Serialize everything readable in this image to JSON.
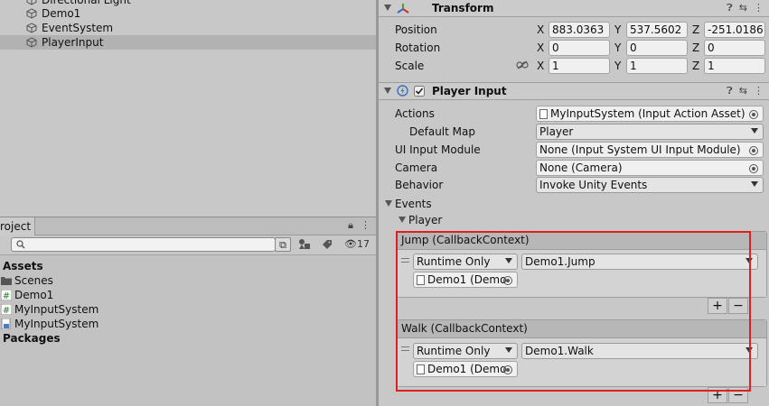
{
  "hierarchy": {
    "items": [
      {
        "label": "Directional Light"
      },
      {
        "label": "Demo1"
      },
      {
        "label": "EventSystem"
      },
      {
        "label": "PlayerInput",
        "selected": true
      }
    ]
  },
  "project": {
    "tab_label": "roject",
    "search_placeholder": "",
    "hidden_count": "17",
    "items": [
      {
        "label": "Assets",
        "kind": "root"
      },
      {
        "label": "Scenes",
        "kind": "folder"
      },
      {
        "label": "Demo1",
        "kind": "script"
      },
      {
        "label": "MyInputSystem",
        "kind": "script"
      },
      {
        "label": "MyInputSystem",
        "kind": "asset"
      },
      {
        "label": "Packages",
        "kind": "root"
      }
    ]
  },
  "transform": {
    "title": "Transform",
    "position_label": "Position",
    "rotation_label": "Rotation",
    "scale_label": "Scale",
    "axis_x": "X",
    "axis_y": "Y",
    "axis_z": "Z",
    "position": {
      "x": "883.0363",
      "y": "537.5602",
      "z": "-251.0186"
    },
    "rotation": {
      "x": "0",
      "y": "0",
      "z": "0"
    },
    "scale": {
      "x": "1",
      "y": "1",
      "z": "1"
    }
  },
  "player_input": {
    "title": "Player Input",
    "enabled": true,
    "actions_label": "Actions",
    "actions_value": "MyInputSystem (Input Action Asset)",
    "default_map_label": "Default Map",
    "default_map_value": "Player",
    "ui_input_module_label": "UI Input Module",
    "ui_input_module_value": "None (Input System UI Input Module)",
    "camera_label": "Camera",
    "camera_value": "None (Camera)",
    "behavior_label": "Behavior",
    "behavior_value": "Invoke Unity Events",
    "events_label": "Events",
    "player_label": "Player",
    "events": [
      {
        "title": "Jump (CallbackContext)",
        "runtime": "Runtime Only",
        "function": "Demo1.Jump",
        "target": "Demo1 (Demo"
      },
      {
        "title": "Walk (CallbackContext)",
        "runtime": "Runtime Only",
        "function": "Demo1.Walk",
        "target": "Demo1 (Demo"
      }
    ],
    "plus": "+",
    "minus": "−"
  },
  "colors": {
    "highlight_outline": "#e02020"
  }
}
